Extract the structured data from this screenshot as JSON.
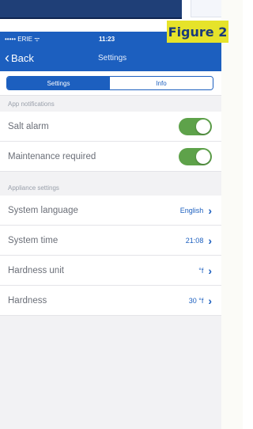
{
  "status_bar": {
    "carrier": "••••• ERIE",
    "wifi_icon": "wifi-icon",
    "time": "11:23"
  },
  "nav": {
    "back_label": "Back",
    "title": "Settings"
  },
  "tabs": [
    {
      "label": "Settings",
      "active": true
    },
    {
      "label": "Info",
      "active": false
    }
  ],
  "app_notifications": {
    "header": "App notifications",
    "items": [
      {
        "label": "Salt alarm",
        "enabled": true
      },
      {
        "label": "Maintenance required",
        "enabled": true
      }
    ]
  },
  "appliance_settings": {
    "header": "Appliance settings",
    "items": [
      {
        "label": "System language",
        "value": "English"
      },
      {
        "label": "System time",
        "value": "21:08"
      },
      {
        "label": "Hardness unit",
        "value": "°f"
      },
      {
        "label": "Hardness",
        "value": "30 °f"
      }
    ]
  },
  "figure_label": "Figure 2",
  "colors": {
    "primary": "#1c5fbf",
    "toggle_on": "#5ea24a",
    "figure_bg": "#e6e32a",
    "figure_text": "#1a3a7a"
  }
}
